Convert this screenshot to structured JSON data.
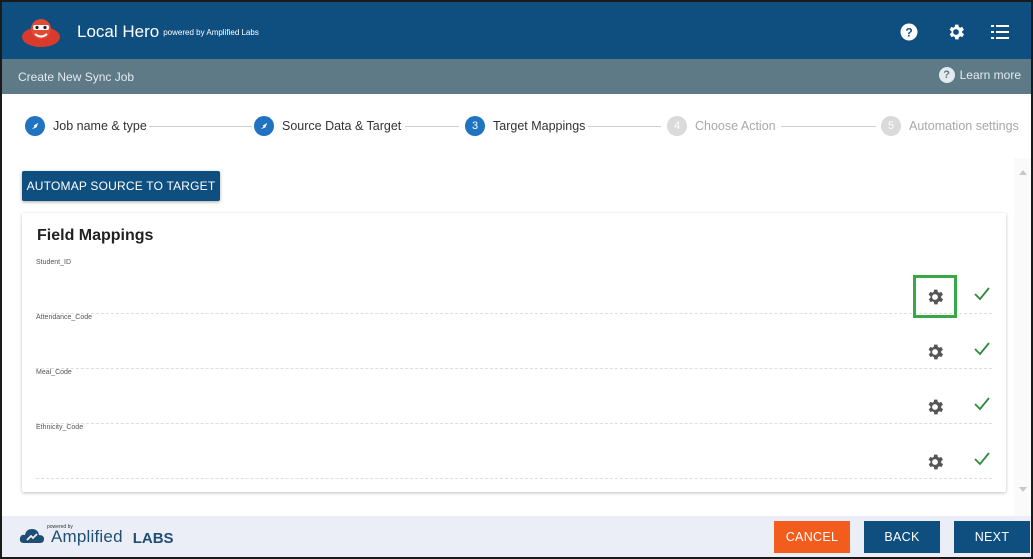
{
  "app": {
    "name": "Local Hero",
    "powered": "powered by Amplified Labs"
  },
  "subheader": {
    "title": "Create New Sync Job",
    "learn_more": "Learn more"
  },
  "steps": [
    {
      "label": "Job name & type",
      "marker": "✓",
      "state": "done"
    },
    {
      "label": "Source Data & Target",
      "marker": "✓",
      "state": "done"
    },
    {
      "label": "Target Mappings",
      "marker": "3",
      "state": "active"
    },
    {
      "label": "Choose Action",
      "marker": "4",
      "state": "todo"
    },
    {
      "label": "Automation settings",
      "marker": "5",
      "state": "todo"
    }
  ],
  "automap_label": "AUTOMAP SOURCE TO TARGET",
  "card": {
    "title": "Field Mappings",
    "mappings": [
      {
        "field": "Student_ID"
      },
      {
        "field": "Attendance_Code"
      },
      {
        "field": "Meal_Code"
      },
      {
        "field": "Ethnicity_Code"
      }
    ]
  },
  "footer": {
    "powered_by": "powered by",
    "brand": "Amplified",
    "brand_suffix": "LABS",
    "cancel": "CANCEL",
    "back": "BACK",
    "next": "NEXT"
  },
  "colors": {
    "primary": "#0e4f80",
    "subheader": "#5e7a87",
    "step_active": "#1f73c0",
    "cancel": "#f25c1d",
    "check": "#2e8b3e",
    "highlight": "#38a846"
  },
  "icons": [
    "help-icon",
    "settings-icon",
    "menu-icon",
    "gear-icon",
    "check-icon"
  ]
}
